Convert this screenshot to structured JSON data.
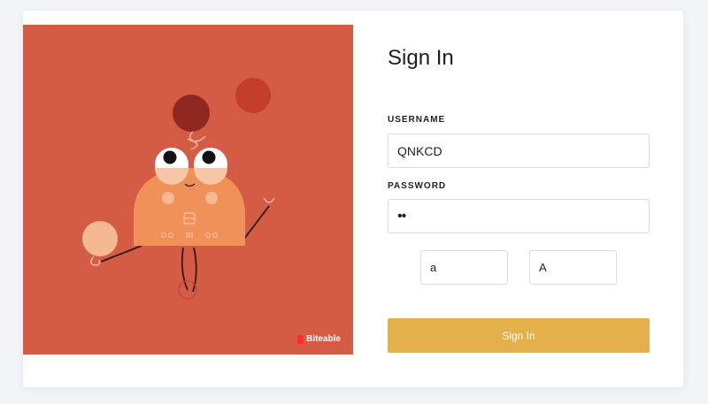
{
  "form": {
    "title": "Sign In",
    "username_label": "USERNAME",
    "username_value": "QNKCD",
    "password_label": "PASSWORD",
    "password_value": "••",
    "field_a_value": "a",
    "field_b_value": "A",
    "submit_label": "Sign In"
  },
  "illustration": {
    "brand": "Biteable"
  },
  "colors": {
    "illustration_bg": "#d45c45",
    "button": "#e3b04b",
    "character": "#f0915a"
  }
}
